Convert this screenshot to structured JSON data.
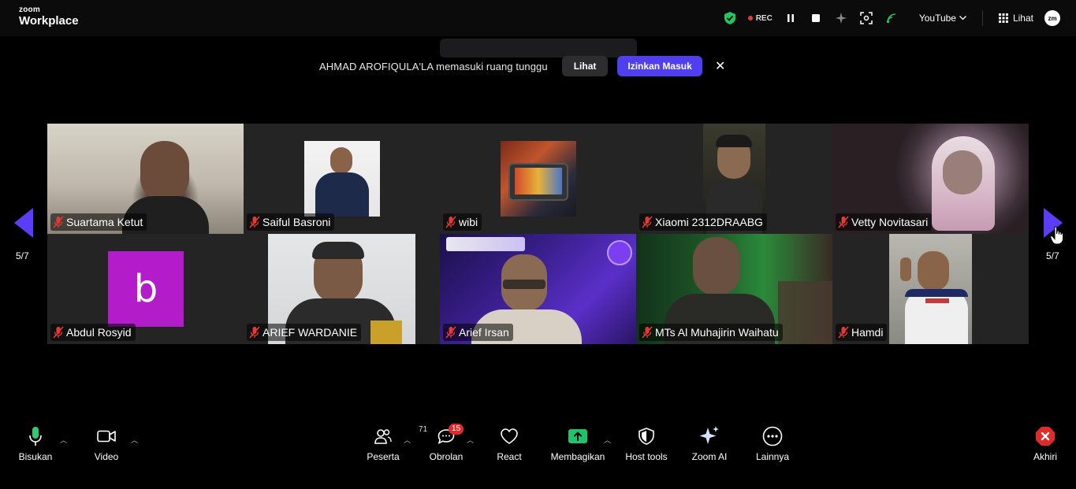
{
  "app": {
    "brand_small": "zoom",
    "brand_large": "Workplace"
  },
  "topbar": {
    "rec_label": "REC",
    "stream_label": "YouTube",
    "view_label": "Lihat",
    "avatar_initials": "zm"
  },
  "notification": {
    "message": "AHMAD AROFIQULA'LA memasuki ruang tunggu",
    "view_button": "Lihat",
    "admit_button": "Izinkan Masuk"
  },
  "gallery": {
    "page_left": "5/7",
    "page_right": "5/7",
    "participants": [
      {
        "name": "Suartama Ketut",
        "muted": true
      },
      {
        "name": "Saiful Basroni",
        "muted": true
      },
      {
        "name": "wibi",
        "muted": true
      },
      {
        "name": "Xiaomi 2312DRAABG",
        "muted": true
      },
      {
        "name": "Vetty Novitasari",
        "muted": true
      },
      {
        "name": "Abdul Rosyid",
        "muted": true,
        "avatar_letter": "b"
      },
      {
        "name": "ARIEF WARDANIE",
        "muted": true
      },
      {
        "name": "Arief Irsan",
        "muted": true
      },
      {
        "name": "MTs Al Muhajirin Waihatu",
        "muted": true
      },
      {
        "name": "Hamdi",
        "muted": true
      }
    ]
  },
  "toolbar": {
    "mic_label": "Bisukan",
    "video_label": "Video",
    "participants_label": "Peserta",
    "participants_count": "71",
    "chat_label": "Obrolan",
    "chat_badge": "15",
    "react_label": "React",
    "share_label": "Membagikan",
    "host_tools_label": "Host tools",
    "ai_label": "Zoom AI",
    "more_label": "Lainnya",
    "end_label": "Akhiri"
  },
  "colors": {
    "accent": "#4f3ff0",
    "arrow": "#5b3df5",
    "share_green": "#1fc36a",
    "end_red": "#e02b2b",
    "mute_red": "#e53935",
    "avatar_purple": "#b21cc9"
  }
}
